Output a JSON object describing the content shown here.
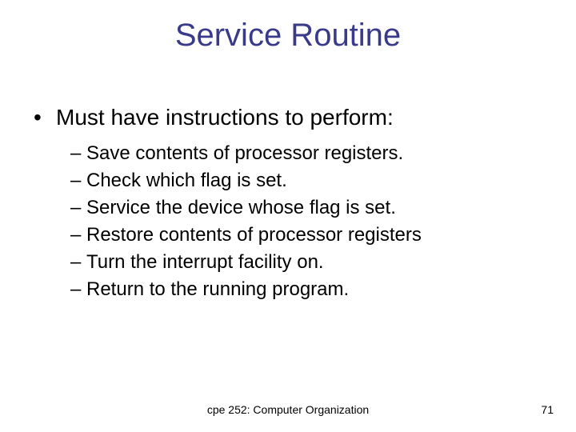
{
  "title": "Service Routine",
  "bullets": {
    "l1": "Must have instructions to perform:",
    "l2": [
      "Save contents of processor registers.",
      "Check which flag is set.",
      "Service the device whose flag is set.",
      "Restore contents of processor registers",
      "Turn the interrupt facility on.",
      "Return to the running program."
    ]
  },
  "footer": {
    "course": "cpe 252: Computer Organization",
    "page": "71"
  }
}
